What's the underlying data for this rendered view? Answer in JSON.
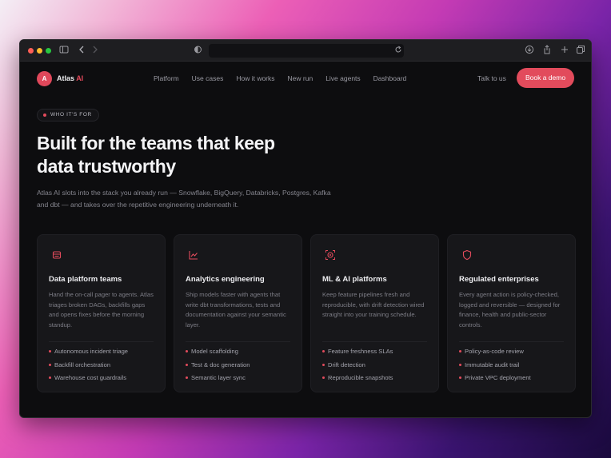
{
  "nav": {
    "logo_letter": "A",
    "brand": "Atlas",
    "brand_accent": "AI",
    "links": [
      "Platform",
      "Use cases",
      "How it works",
      "New run",
      "Live agents",
      "Dashboard"
    ],
    "talk": "Talk to us",
    "cta": "Book a demo"
  },
  "hero": {
    "eyebrow": "WHO IT'S FOR",
    "title": "Built for the teams that keep data trustworthy",
    "subtitle": "Atlas AI slots into the stack you already run — Snowflake, BigQuery, Databricks, Postgres, Kafka and dbt — and takes over the repetitive engineering underneath it."
  },
  "cards": [
    {
      "icon": "database-icon",
      "title": "Data platform teams",
      "desc": "Hand the on-call pager to agents. Atlas triages broken DAGs, backfills gaps and opens fixes before the morning standup.",
      "items": [
        "Autonomous incident triage",
        "Backfill orchestration",
        "Warehouse cost guardrails"
      ]
    },
    {
      "icon": "line-chart-icon",
      "title": "Analytics engineering",
      "desc": "Ship models faster with agents that write dbt transformations, tests and documentation against your semantic layer.",
      "items": [
        "Model scaffolding",
        "Test & doc generation",
        "Semantic layer sync"
      ]
    },
    {
      "icon": "brain-target-icon",
      "title": "ML & AI platforms",
      "desc": "Keep feature pipelines fresh and reproducible, with drift detection wired straight into your training schedule.",
      "items": [
        "Feature freshness SLAs",
        "Drift detection",
        "Reproducible snapshots"
      ]
    },
    {
      "icon": "shield-icon",
      "title": "Regulated enterprises",
      "desc": "Every agent action is policy-checked, logged and reversible — designed for finance, health and public-sector controls.",
      "items": [
        "Policy-as-code review",
        "Immutable audit trail",
        "Private VPC deployment"
      ]
    }
  ],
  "colors": {
    "accent": "#e24b5c",
    "bg": "#0d0d0f",
    "card": "#17171a"
  }
}
